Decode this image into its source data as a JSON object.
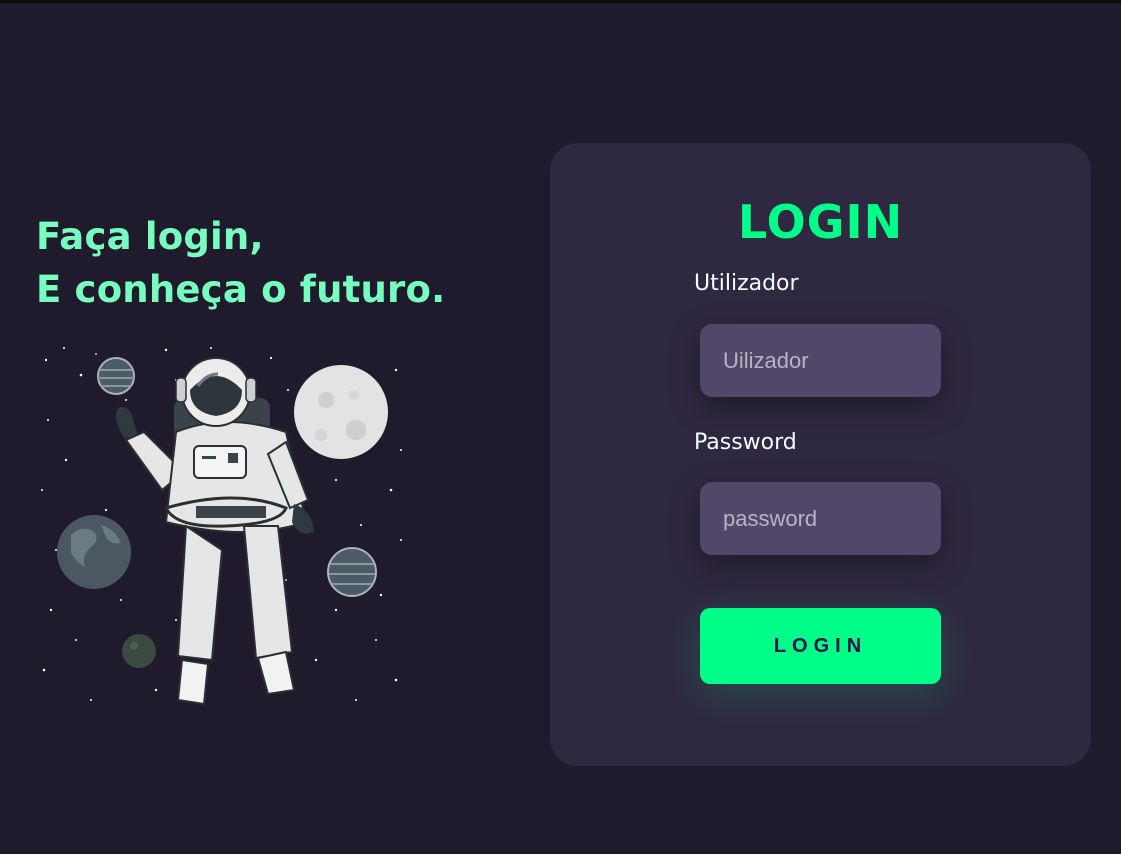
{
  "hero": {
    "line1": "Faça login,",
    "line2": "E conheça o futuro."
  },
  "illustration": {
    "name": "astronaut-illustration"
  },
  "login": {
    "title": "LOGIN",
    "user_label": "Utilizador",
    "user_placeholder": "Uilizador",
    "password_label": "Password",
    "password_placeholder": "password",
    "button_label": "LOGIN"
  },
  "colors": {
    "background": "#201b2c",
    "card": "#2f2841",
    "field": "#514869",
    "accent": "#00ff88",
    "headline": "#77ffc0"
  }
}
